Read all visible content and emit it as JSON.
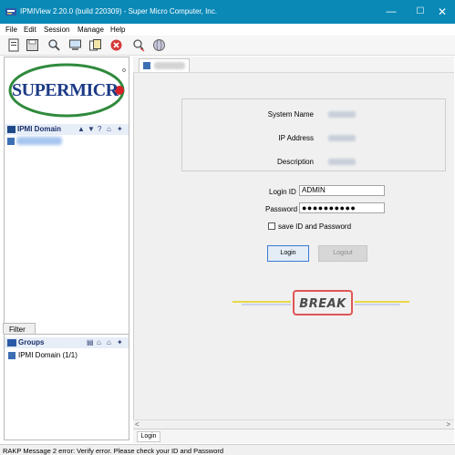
{
  "window": {
    "title": "IPMIView 2.20.0 (build 220309) - Super Micro Computer, Inc.",
    "minimize": "—",
    "maximize": "☐",
    "close": "✕"
  },
  "menu": [
    "File",
    "Edit",
    "Session",
    "Manage",
    "Help"
  ],
  "toolbar": {
    "icons": [
      "new-icon",
      "save-icon",
      "search-icon",
      "monitor-icon",
      "copy-icon",
      "stop-icon",
      "disconnect-icon",
      "globe-icon"
    ]
  },
  "sidebar": {
    "logo_text": "SUPERMICR",
    "domain_header": "IPMI Domain",
    "domain_controls": [
      "▲",
      "▼",
      "?",
      "⌂",
      "✦"
    ],
    "filter_label": "Filter",
    "groups_header": "Groups",
    "groups_controls": [
      "▤",
      "⌂",
      "⌂",
      "✦"
    ],
    "group_items": [
      {
        "label": "IPMI Domain (1/1)"
      }
    ]
  },
  "main": {
    "system_info": {
      "system_name_label": "System Name",
      "ip_address_label": "IP Address",
      "description_label": "Description"
    },
    "login": {
      "login_id_label": "Login ID",
      "login_id_value": "ADMIN",
      "password_label": "Password",
      "password_value": "●●●●●●●●●●",
      "save_checkbox_label": "save ID and Password",
      "login_button": "Login",
      "logout_button": "Logout"
    },
    "status_logo": "BREAK",
    "bottom_tab": "Login",
    "scroll_left": "<",
    "scroll_right": ">"
  },
  "statusbar": {
    "message": "RAKP Message 2 error: Verify error. Please check your ID and Password"
  },
  "colors": {
    "titlebar": "#0a89b7",
    "logo_ring": "#2f8a3c",
    "logo_text": "#1d3b86",
    "break_border": "#e05555",
    "break_lines": "#e8d84a"
  }
}
